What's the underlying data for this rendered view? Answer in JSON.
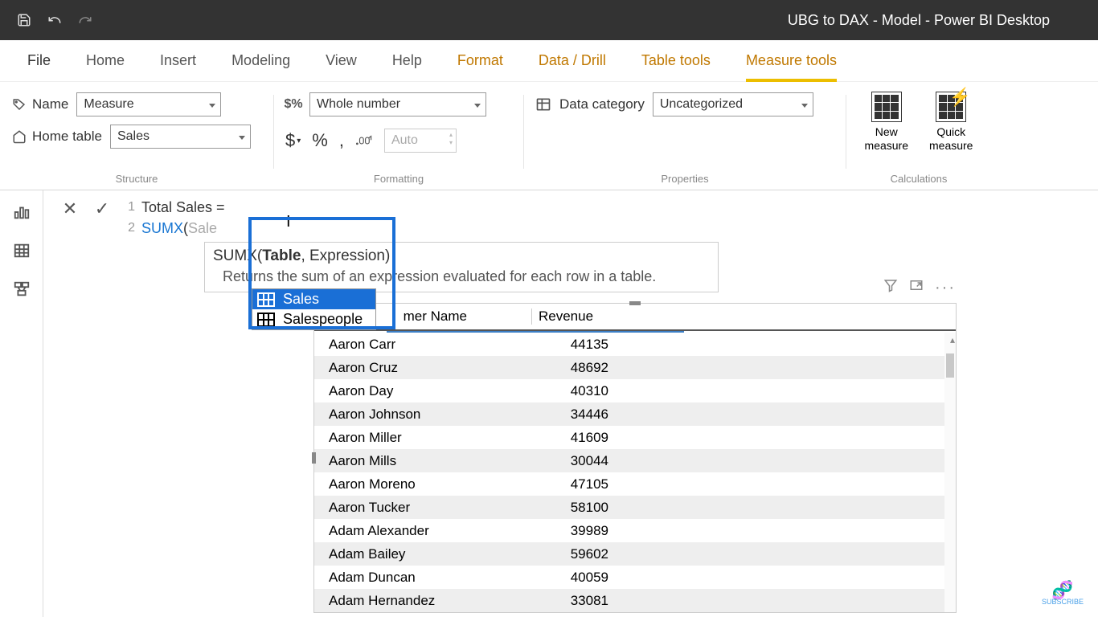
{
  "titlebar": {
    "title": "UBG to DAX - Model - Power BI Desktop"
  },
  "ribbonTabs": [
    {
      "label": "File",
      "cls": "file"
    },
    {
      "label": "Home"
    },
    {
      "label": "Insert"
    },
    {
      "label": "Modeling"
    },
    {
      "label": "View"
    },
    {
      "label": "Help"
    },
    {
      "label": "Format",
      "cls": "yellow"
    },
    {
      "label": "Data / Drill",
      "cls": "yellow"
    },
    {
      "label": "Table tools",
      "cls": "yellow"
    },
    {
      "label": "Measure tools",
      "cls": "yellow active"
    }
  ],
  "structure": {
    "nameLabel": "Name",
    "nameValue": "Measure",
    "homeTableLabel": "Home table",
    "homeTableValue": "Sales",
    "groupLabel": "Structure"
  },
  "formatting": {
    "formatValue": "Whole number",
    "autoValue": "Auto",
    "dollar": "$",
    "percent": "%",
    "comma": ",",
    "decimals": ".00",
    "groupLabel": "Formatting"
  },
  "properties": {
    "catLabel": "Data category",
    "catValue": "Uncategorized",
    "groupLabel": "Properties"
  },
  "calculations": {
    "newMeasure": "New\nmeasure",
    "quickMeasure": "Quick\nmeasure",
    "groupLabel": "Calculations"
  },
  "formula": {
    "line1_num": "1",
    "line1_text": "Total Sales =",
    "line2_num": "2",
    "line2_func": "SUMX",
    "line2_paren": "(",
    "line2_typed": " Sale"
  },
  "tooltip": {
    "func": "SUMX",
    "sig_open": "(",
    "sig_p1": "Table",
    "sig_rest": ", Expression)",
    "desc": "Returns the sum of an expression evaluated for each row in a table."
  },
  "intellisense": {
    "items": [
      {
        "label": "Sales",
        "selected": true
      },
      {
        "label": "Salespeople",
        "selected": false
      }
    ]
  },
  "visual": {
    "headers": {
      "name": "mer Name",
      "revenue": "Revenue"
    },
    "rows": [
      {
        "name": "Aaron Carr",
        "revenue": 44135
      },
      {
        "name": "Aaron Cruz",
        "revenue": 48692
      },
      {
        "name": "Aaron Day",
        "revenue": 40310
      },
      {
        "name": "Aaron Johnson",
        "revenue": 34446
      },
      {
        "name": "Aaron Miller",
        "revenue": 41609
      },
      {
        "name": "Aaron Mills",
        "revenue": 30044
      },
      {
        "name": "Aaron Moreno",
        "revenue": 47105
      },
      {
        "name": "Aaron Tucker",
        "revenue": 58100
      },
      {
        "name": "Adam Alexander",
        "revenue": 39989
      },
      {
        "name": "Adam Bailey",
        "revenue": 59602
      },
      {
        "name": "Adam Duncan",
        "revenue": 40059
      },
      {
        "name": "Adam Hernandez",
        "revenue": 33081
      }
    ]
  },
  "subscribe": "SUBSCRIBE"
}
